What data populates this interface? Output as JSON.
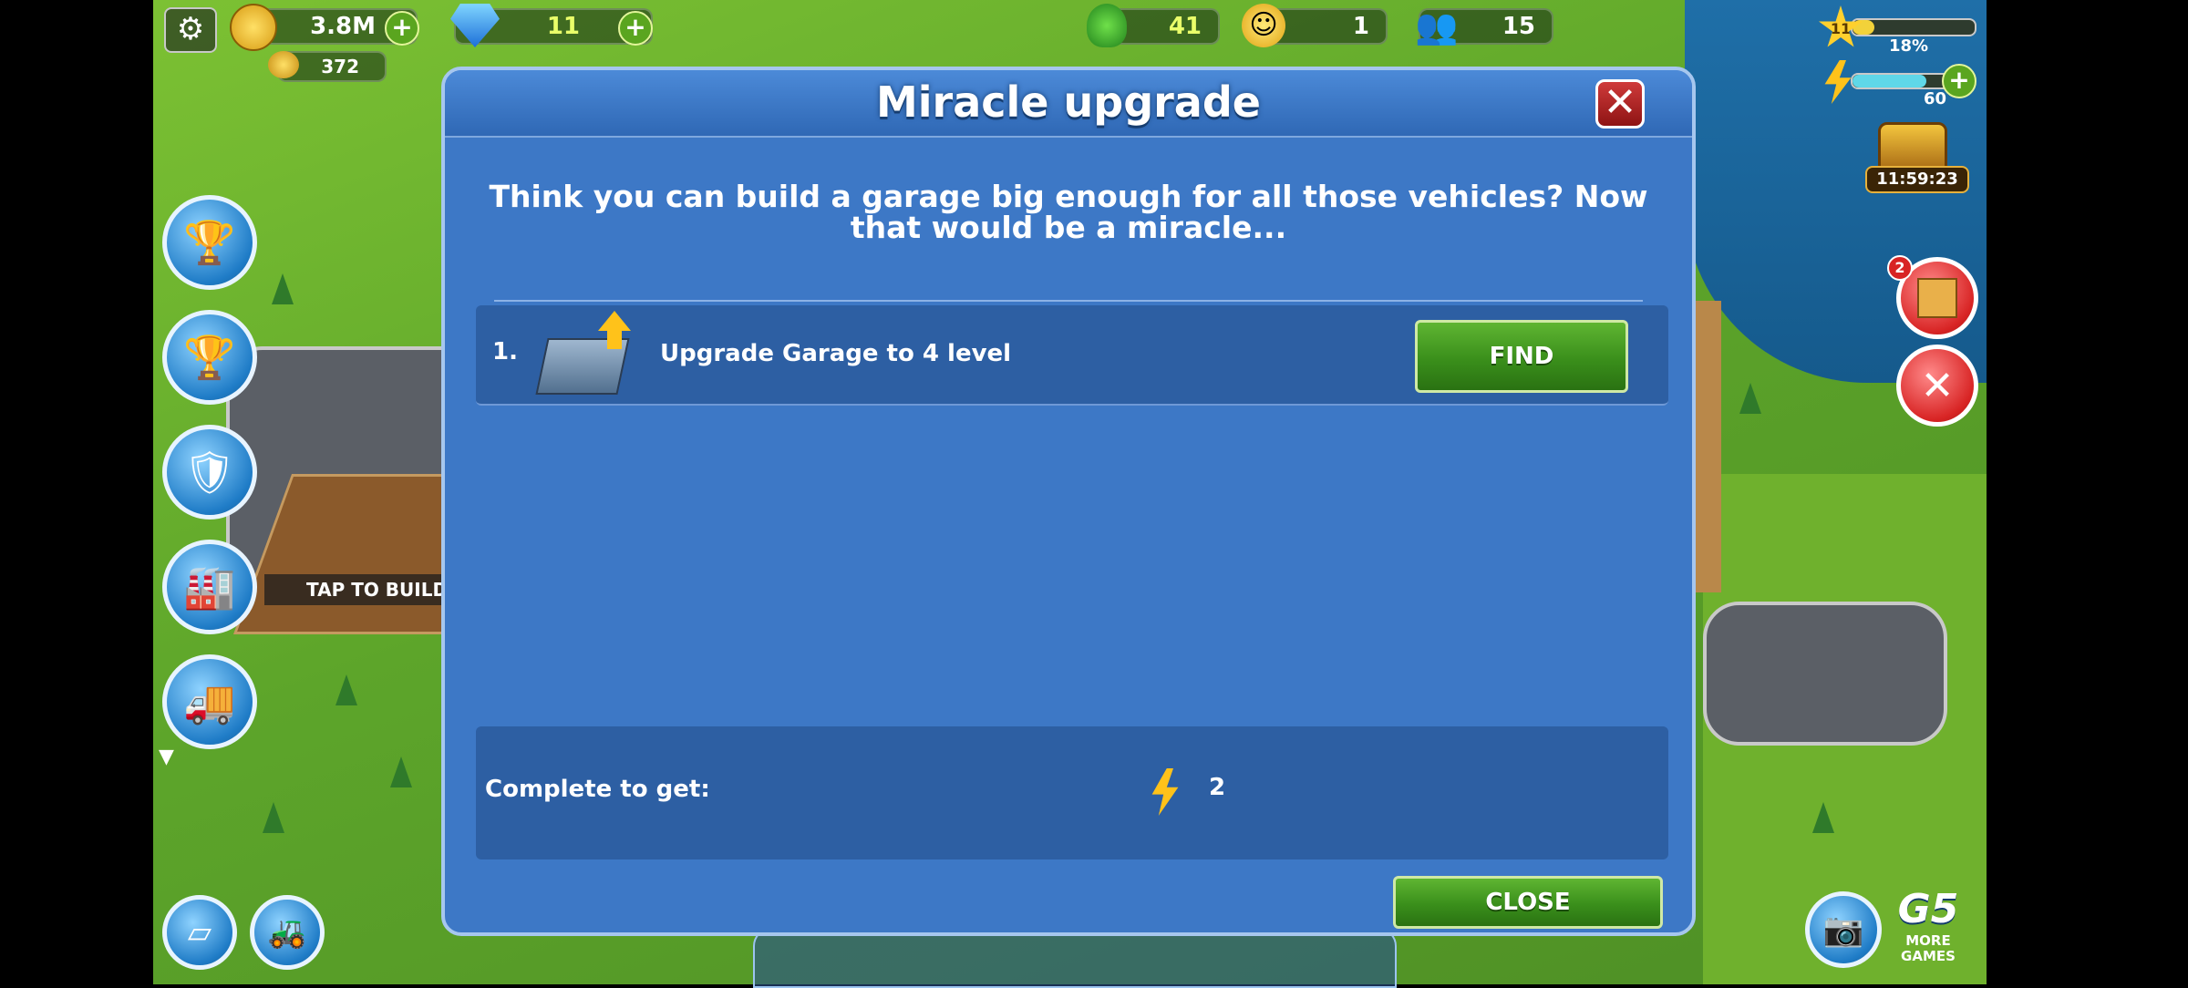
{
  "hud": {
    "money": "3.8M",
    "gems": "11",
    "greens": "41",
    "happiness": "1",
    "population": "15",
    "gold": "372",
    "level": "11",
    "xp_percent": "18%",
    "xp_fraction": 0.18,
    "energy": "60",
    "chest_timer": "11:59:23",
    "tools_badge": "2"
  },
  "left_panel": {
    "tap_to_build": "TAP TO BUILD: G"
  },
  "dialog": {
    "title": "Miracle upgrade",
    "intro": "Think you can build a garage big enough for all those vehicles? Now that would be a miracle...",
    "tasks": [
      {
        "number": "1.",
        "label": "Upgrade Garage to 4 level",
        "button": "FIND"
      }
    ],
    "reward_label": "Complete to get:",
    "reward_value": "2",
    "close_button": "CLOSE"
  },
  "brand": {
    "logo": "G5",
    "more_games": "MORE GAMES"
  },
  "colors": {
    "dialog_bg": "#3d78c6",
    "row_bg": "#2d5fa3",
    "button_green": "#3a8f1b",
    "close_red": "#b02020"
  }
}
